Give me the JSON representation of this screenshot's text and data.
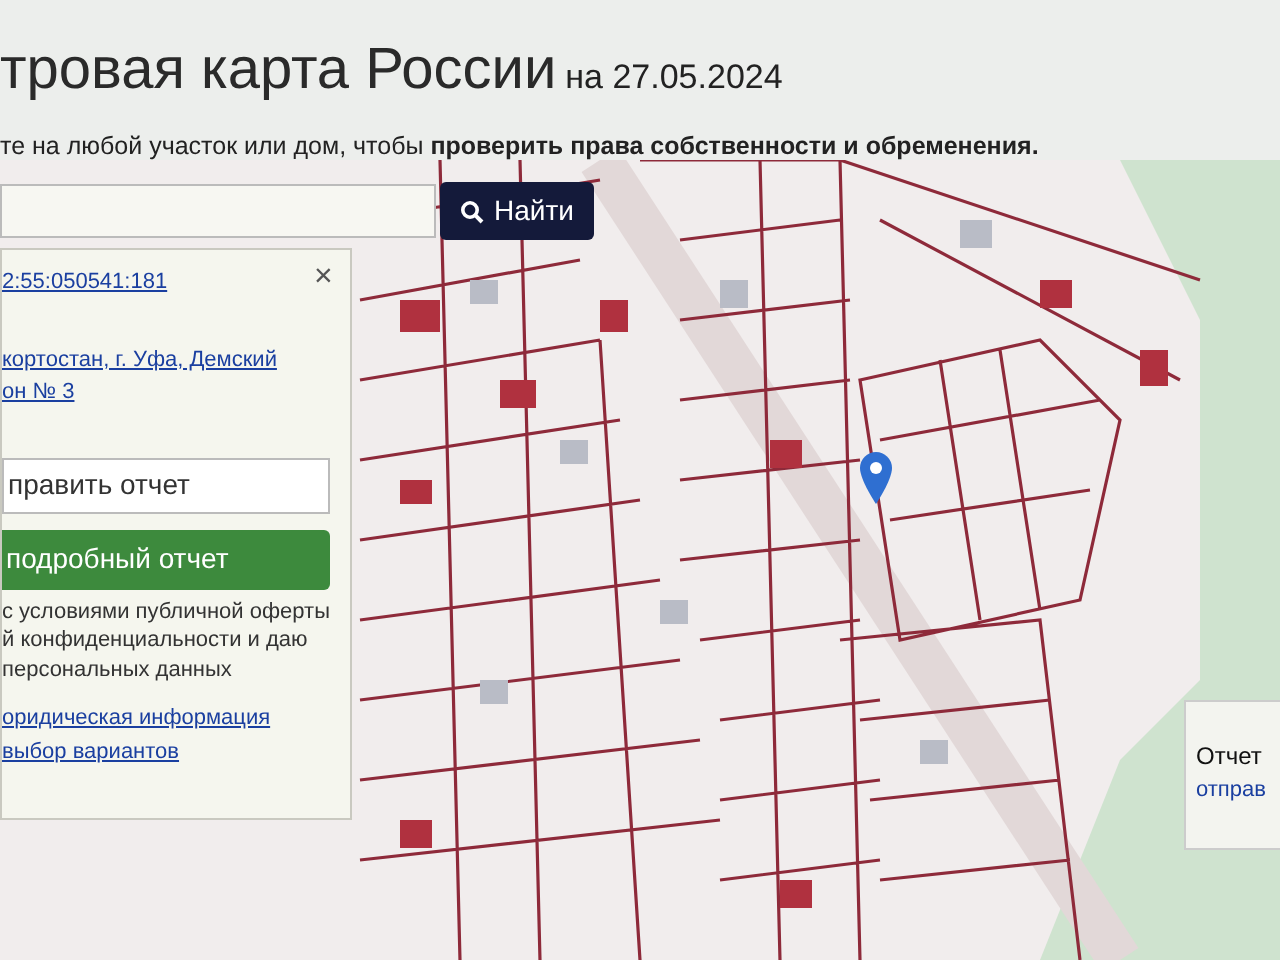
{
  "header": {
    "title": "тровая карта России",
    "date": "на 27.05.2024",
    "subtitle": "те на любой участок или дом, чтобы **проверить права собственности и обременения.**"
  },
  "search": {
    "button": "Найти"
  },
  "info_panel": {
    "close": "×",
    "cadastral_number": "2:55:050541:181",
    "address_lines": [
      "кортостан, г. Уфа, Демский",
      "он № 3"
    ],
    "send_button": "править отчет",
    "report_button": "подробный отчет",
    "terms_lines": [
      "с условиями публичной оферты",
      "й конфиденциальности и даю",
      "персональных данных"
    ],
    "links": [
      "оридическая информация",
      "выбор вариантов"
    ]
  },
  "side_panel": {
    "title": "Отчет",
    "text": "отправ"
  }
}
